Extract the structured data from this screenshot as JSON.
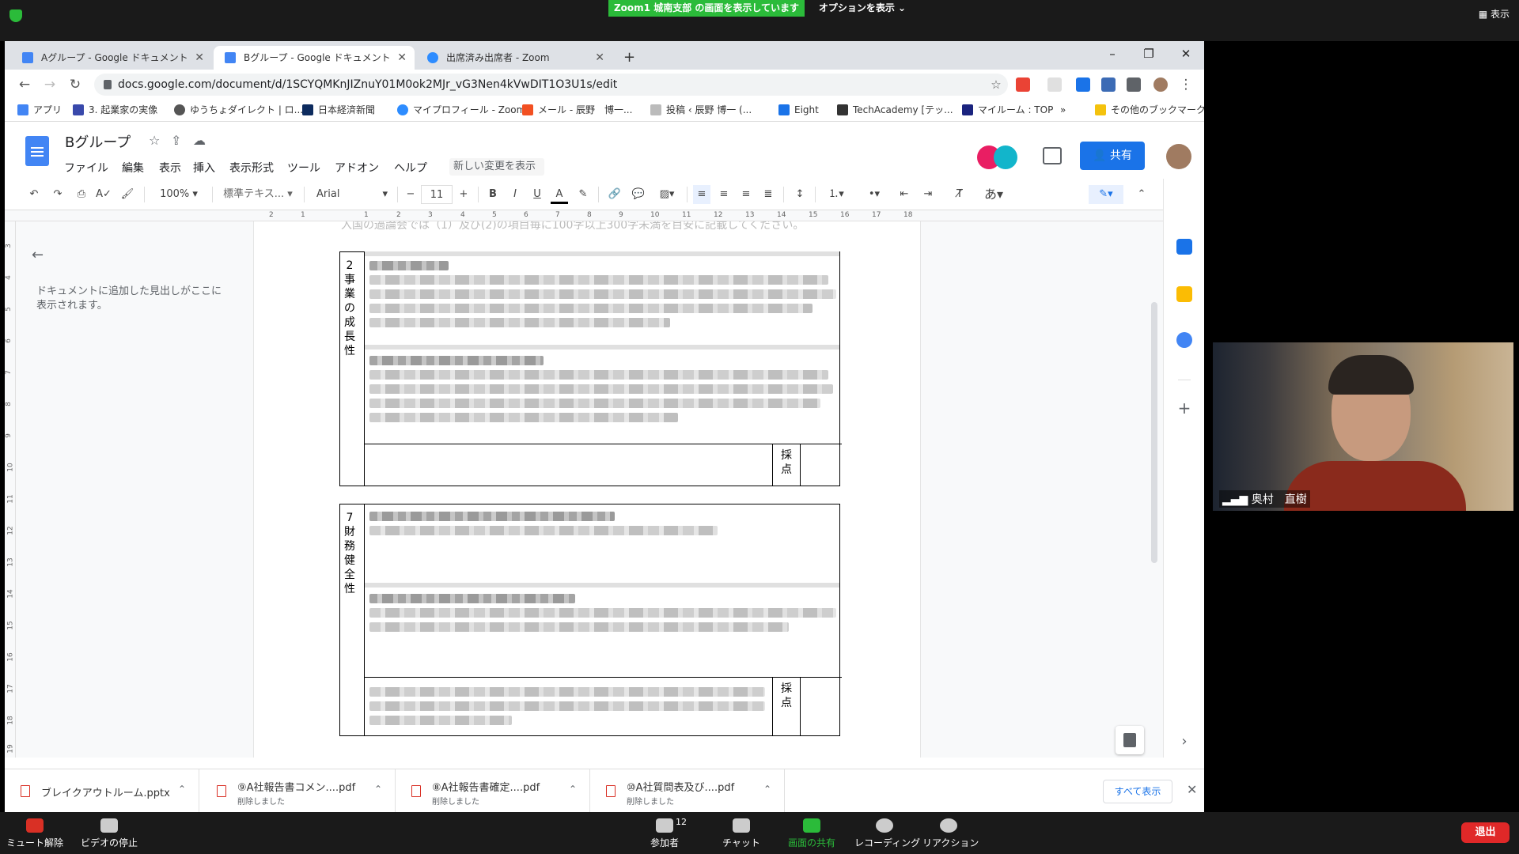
{
  "zoom": {
    "share_banner": "Zoom1 城南支部 の画面を表示しています",
    "options_label": "オプションを表示 ⌄",
    "view_label": "▦ 表示",
    "participant_count": "12",
    "controls": [
      "ミュート解除",
      "ビデオの停止",
      "参加者",
      "チャット",
      "画面の共有",
      "レコーディング",
      "リアクション"
    ],
    "leave_label": "退出",
    "video_name": "奥村　直樹"
  },
  "browser": {
    "tabs": [
      {
        "label": "Aグループ - Google ドキュメント"
      },
      {
        "label": "Bグループ - Google ドキュメント"
      },
      {
        "label": "出席済み出席者 - Zoom"
      }
    ],
    "new_tab": "+",
    "url": "docs.google.com/document/d/1SCYQMKnJIZnuY01M0ok2MJr_vG3Nen4kVwDIT1O3U1s/edit",
    "bookmarks": [
      "アプリ",
      "3. 起業家の実像",
      "ゆうちょダイレクト | ロ...",
      "日本経済新聞",
      "マイプロフィール - Zoom",
      "メール - 辰野　博一...",
      "投稿 ‹ 辰野 博一 (...",
      "Eight",
      "TechAcademy [テッ...",
      "マイルーム : TOP",
      "»",
      "その他のブックマーク"
    ]
  },
  "docs": {
    "title": "Bグループ",
    "menus": [
      "ファイル",
      "編集",
      "表示",
      "挿入",
      "表示形式",
      "ツール",
      "アドオン",
      "ヘルプ"
    ],
    "last_edit": "新しい変更を表示",
    "share_label": "共有",
    "zoom_level": "100%",
    "style": "標準テキス...",
    "font": "Arial",
    "font_size": "11",
    "ruler": [
      "2",
      "1",
      "1",
      "2",
      "3",
      "4",
      "5",
      "6",
      "7",
      "8",
      "9",
      "10",
      "11",
      "12",
      "13",
      "14",
      "15",
      "16",
      "17",
      "18"
    ],
    "vruler": [
      "3",
      "4",
      "5",
      "6",
      "7",
      "8",
      "9",
      "10",
      "11",
      "12",
      "13",
      "14",
      "15",
      "16",
      "17",
      "18",
      "19"
    ],
    "outline_hint": "ドキュメントに追加した見出しがここに表示されます。",
    "top_text": "入国の過論会では（1）及び(2)の項目毎に100字以上300字未満を目安に記載してください。",
    "table1_label": "2\n事\n業\nの\n成\n長\n性",
    "table2_label": "7\n財\n務\n健\n全\n性",
    "score_label": "採\n点"
  },
  "downloads": [
    {
      "name": "ブレイクアウトルーム.pptx",
      "status": ""
    },
    {
      "name": "⑨A社報告書コメン....pdf",
      "status": "削除しました"
    },
    {
      "name": "⑧A社報告書確定....pdf",
      "status": "削除しました"
    },
    {
      "name": "⑩A社質問表及び....pdf",
      "status": "削除しました"
    }
  ],
  "show_all": "すべて表示"
}
